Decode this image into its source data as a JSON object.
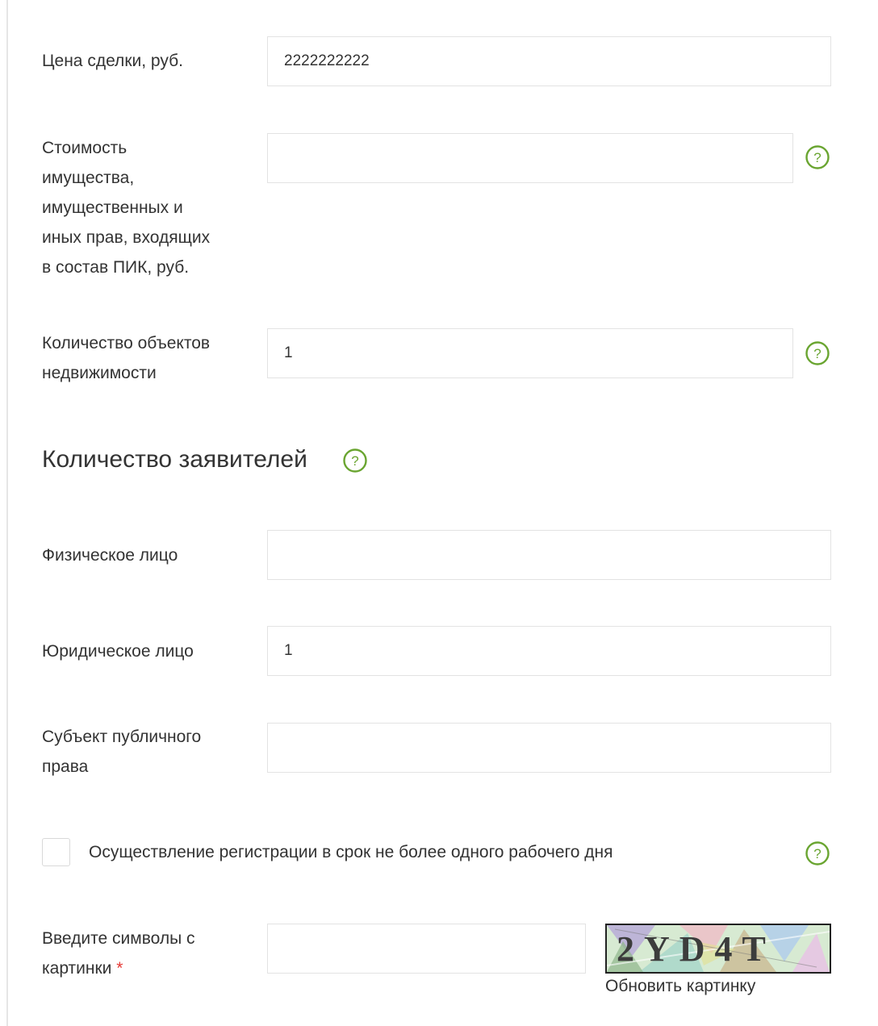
{
  "fields": {
    "deal_price": {
      "label": "Цена сделки, руб.",
      "value": "2222222222"
    },
    "property_value": {
      "label_lines": [
        "Стоимость",
        "имущества,",
        "имущественных и",
        "иных прав, входящих",
        "в состав ПИК, руб."
      ],
      "value": ""
    },
    "objects_count": {
      "label_lines": [
        "Количество объектов",
        "недвижимости"
      ],
      "value": "1"
    }
  },
  "applicants": {
    "title": "Количество заявителей",
    "individual": {
      "label": "Физическое лицо",
      "value": ""
    },
    "legal_entity": {
      "label": "Юридическое лицо",
      "value": "1"
    },
    "public_entity": {
      "label_lines": [
        "Субъект публичного",
        "права"
      ],
      "value": ""
    }
  },
  "express_registration": {
    "label": "Осуществление регистрации в срок не более одного рабочего дня",
    "checked": false
  },
  "captcha": {
    "label_lines": [
      "Введите символы с",
      "картинки"
    ],
    "required_mark": "*",
    "value": "",
    "image_text": "2YD4T",
    "refresh_label": "Обновить картинку"
  },
  "icons": {
    "help": "question-circle-icon"
  },
  "colors": {
    "help_icon": "#6aa531",
    "required": "#e53935",
    "input_border": "#e3e3e3",
    "text": "#333333"
  }
}
